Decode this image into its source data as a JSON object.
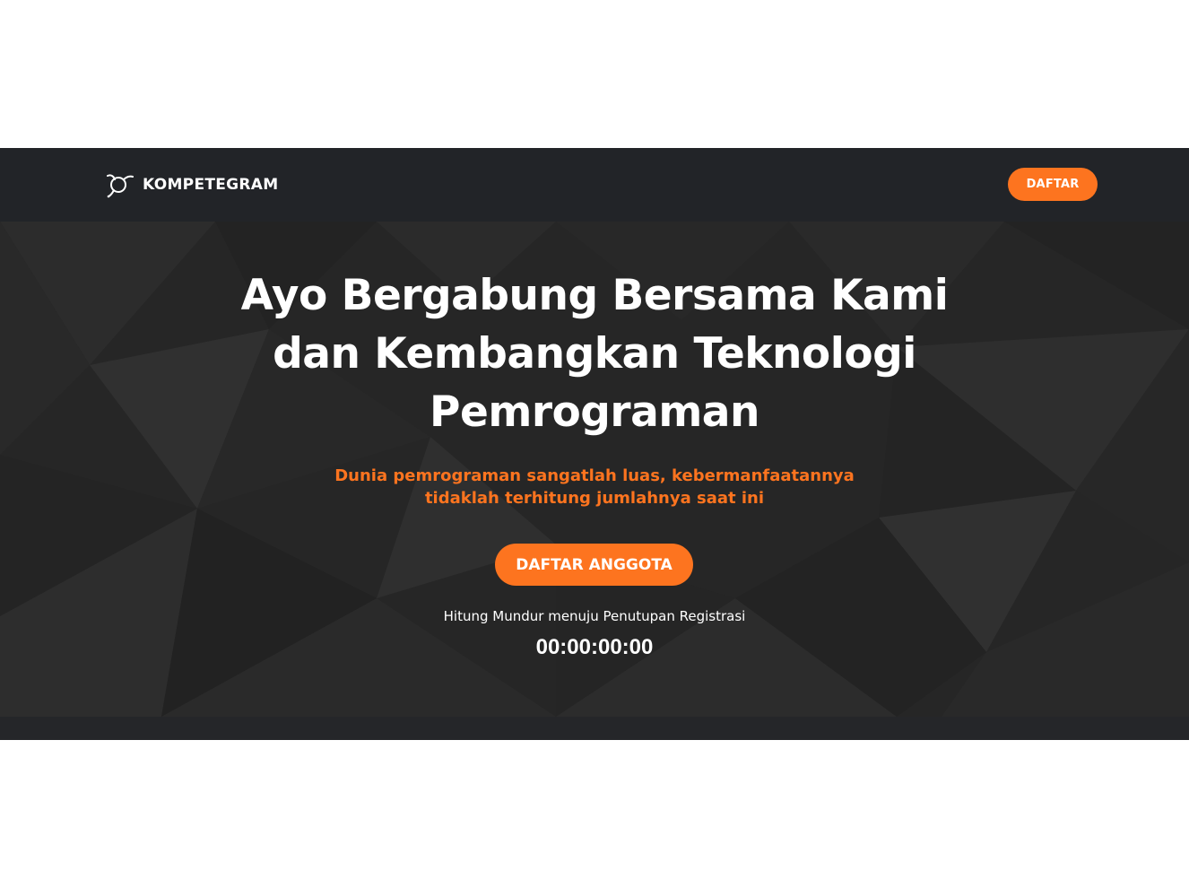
{
  "navbar": {
    "brand_name": "KOMPETEGRAM",
    "brand_icon": "orbit-logo-icon",
    "register_label": "DAFTAR"
  },
  "hero": {
    "headline_lines": [
      "Ayo Bergabung Bersama Kami",
      "dan Kembangkan Teknologi",
      "Pemrograman"
    ],
    "subtitle_lines": [
      "Dunia pemrograman sangatlah luas, kebermanfaatannya",
      "tidaklah terhitung jumlahnya saat ini"
    ],
    "cta_label": "DAFTAR ANGGOTA",
    "countdown_label": "Hitung Mundur menuju Penutupan Registrasi",
    "countdown_value": "00:00:00:00"
  },
  "colors": {
    "accent": "#fd741f",
    "navbar_background": "#222428",
    "hero_background": "#262626",
    "text_primary": "#ffffff"
  }
}
